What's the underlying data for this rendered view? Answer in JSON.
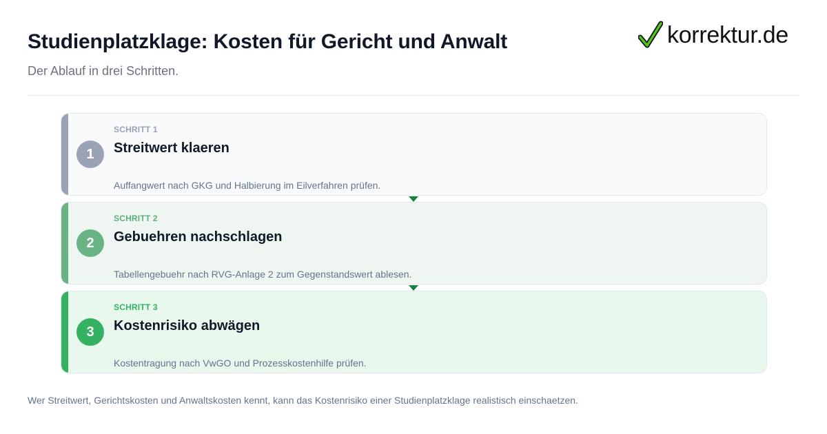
{
  "header": {
    "title": "Studienplatzklage: Kosten für Gericht und Anwalt",
    "subtitle": "Der Ablauf in drei Schritten.",
    "logo_text": "korrektur.de"
  },
  "steps": [
    {
      "number": "1",
      "label": "SCHRITT 1",
      "heading": "Streitwert klaeren",
      "description": "Auffangwert nach GKG und Halbierung im Eilverfahren prüfen.",
      "accent_color": "#9aa3b5",
      "label_color": "#9aa3b5",
      "background": "#f8fafc"
    },
    {
      "number": "2",
      "label": "SCHRITT 2",
      "heading": "Gebuehren nachschlagen",
      "description": "Tabellengebuehr nach RVG-Anlage 2 zum Gegenstandswert ablesen.",
      "accent_color": "#6ab385",
      "label_color": "#5fae7c",
      "background": "#eff6f1"
    },
    {
      "number": "3",
      "label": "SCHRITT 3",
      "heading": "Kostenrisiko abwägen",
      "description": "Kostentragung nach VwGO und Prozesskostenhilfe prüfen.",
      "accent_color": "#34b262",
      "label_color": "#34b262",
      "background": "#e8f8ec"
    }
  ],
  "footer": {
    "text": "Wer Streitwert, Gerichtskosten und Anwaltskosten kennt, kann das Kostenrisiko einer Studienplatzklage realistisch einschaetzen."
  },
  "colors": {
    "arrow": "#15803d",
    "logo_check": "#52c41a"
  }
}
